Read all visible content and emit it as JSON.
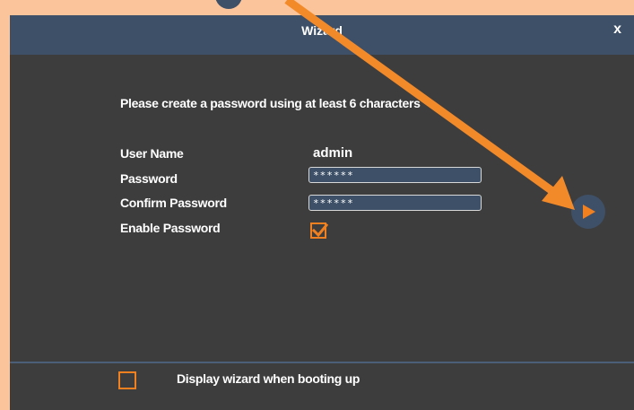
{
  "window": {
    "title": "Wizard",
    "close_label": "x"
  },
  "form": {
    "instruction": "Please create a password using at least 6 characters",
    "user_name_label": "User Name",
    "user_name_value": "admin",
    "password_label": "Password",
    "password_value": "******",
    "confirm_password_label": "Confirm Password",
    "confirm_password_value": "******",
    "enable_password_label": "Enable Password",
    "enable_password_checked": true
  },
  "footer": {
    "display_wizard_label": "Display wizard when booting up",
    "display_wizard_checked": false
  },
  "icons": {
    "next": "play-icon",
    "check": "checkmark-icon",
    "annotation": "orange-arrow"
  },
  "colors": {
    "page_background": "#fcc49a",
    "dialog_background": "#3d3d3d",
    "titlebar": "#3e5068",
    "accent": "#f08020",
    "input_background": "#3d5068"
  }
}
